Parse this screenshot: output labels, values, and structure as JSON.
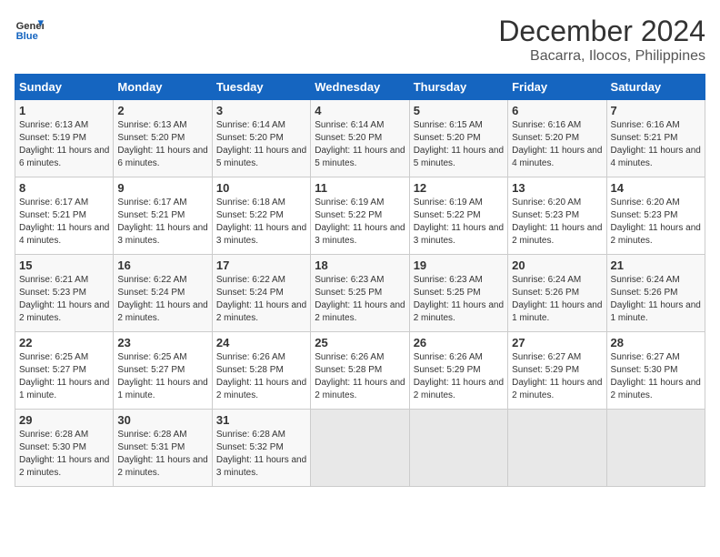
{
  "logo": {
    "line1": "General",
    "line2": "Blue"
  },
  "title": "December 2024",
  "subtitle": "Bacarra, Ilocos, Philippines",
  "days_header": [
    "Sunday",
    "Monday",
    "Tuesday",
    "Wednesday",
    "Thursday",
    "Friday",
    "Saturday"
  ],
  "weeks": [
    [
      {
        "day": "1",
        "sunrise": "6:13 AM",
        "sunset": "5:19 PM",
        "daylight": "11 hours and 6 minutes."
      },
      {
        "day": "2",
        "sunrise": "6:13 AM",
        "sunset": "5:20 PM",
        "daylight": "11 hours and 6 minutes."
      },
      {
        "day": "3",
        "sunrise": "6:14 AM",
        "sunset": "5:20 PM",
        "daylight": "11 hours and 5 minutes."
      },
      {
        "day": "4",
        "sunrise": "6:14 AM",
        "sunset": "5:20 PM",
        "daylight": "11 hours and 5 minutes."
      },
      {
        "day": "5",
        "sunrise": "6:15 AM",
        "sunset": "5:20 PM",
        "daylight": "11 hours and 5 minutes."
      },
      {
        "day": "6",
        "sunrise": "6:16 AM",
        "sunset": "5:20 PM",
        "daylight": "11 hours and 4 minutes."
      },
      {
        "day": "7",
        "sunrise": "6:16 AM",
        "sunset": "5:21 PM",
        "daylight": "11 hours and 4 minutes."
      }
    ],
    [
      {
        "day": "8",
        "sunrise": "6:17 AM",
        "sunset": "5:21 PM",
        "daylight": "11 hours and 4 minutes."
      },
      {
        "day": "9",
        "sunrise": "6:17 AM",
        "sunset": "5:21 PM",
        "daylight": "11 hours and 3 minutes."
      },
      {
        "day": "10",
        "sunrise": "6:18 AM",
        "sunset": "5:22 PM",
        "daylight": "11 hours and 3 minutes."
      },
      {
        "day": "11",
        "sunrise": "6:19 AM",
        "sunset": "5:22 PM",
        "daylight": "11 hours and 3 minutes."
      },
      {
        "day": "12",
        "sunrise": "6:19 AM",
        "sunset": "5:22 PM",
        "daylight": "11 hours and 3 minutes."
      },
      {
        "day": "13",
        "sunrise": "6:20 AM",
        "sunset": "5:23 PM",
        "daylight": "11 hours and 2 minutes."
      },
      {
        "day": "14",
        "sunrise": "6:20 AM",
        "sunset": "5:23 PM",
        "daylight": "11 hours and 2 minutes."
      }
    ],
    [
      {
        "day": "15",
        "sunrise": "6:21 AM",
        "sunset": "5:23 PM",
        "daylight": "11 hours and 2 minutes."
      },
      {
        "day": "16",
        "sunrise": "6:22 AM",
        "sunset": "5:24 PM",
        "daylight": "11 hours and 2 minutes."
      },
      {
        "day": "17",
        "sunrise": "6:22 AM",
        "sunset": "5:24 PM",
        "daylight": "11 hours and 2 minutes."
      },
      {
        "day": "18",
        "sunrise": "6:23 AM",
        "sunset": "5:25 PM",
        "daylight": "11 hours and 2 minutes."
      },
      {
        "day": "19",
        "sunrise": "6:23 AM",
        "sunset": "5:25 PM",
        "daylight": "11 hours and 2 minutes."
      },
      {
        "day": "20",
        "sunrise": "6:24 AM",
        "sunset": "5:26 PM",
        "daylight": "11 hours and 1 minute."
      },
      {
        "day": "21",
        "sunrise": "6:24 AM",
        "sunset": "5:26 PM",
        "daylight": "11 hours and 1 minute."
      }
    ],
    [
      {
        "day": "22",
        "sunrise": "6:25 AM",
        "sunset": "5:27 PM",
        "daylight": "11 hours and 1 minute."
      },
      {
        "day": "23",
        "sunrise": "6:25 AM",
        "sunset": "5:27 PM",
        "daylight": "11 hours and 1 minute."
      },
      {
        "day": "24",
        "sunrise": "6:26 AM",
        "sunset": "5:28 PM",
        "daylight": "11 hours and 2 minutes."
      },
      {
        "day": "25",
        "sunrise": "6:26 AM",
        "sunset": "5:28 PM",
        "daylight": "11 hours and 2 minutes."
      },
      {
        "day": "26",
        "sunrise": "6:26 AM",
        "sunset": "5:29 PM",
        "daylight": "11 hours and 2 minutes."
      },
      {
        "day": "27",
        "sunrise": "6:27 AM",
        "sunset": "5:29 PM",
        "daylight": "11 hours and 2 minutes."
      },
      {
        "day": "28",
        "sunrise": "6:27 AM",
        "sunset": "5:30 PM",
        "daylight": "11 hours and 2 minutes."
      }
    ],
    [
      {
        "day": "29",
        "sunrise": "6:28 AM",
        "sunset": "5:30 PM",
        "daylight": "11 hours and 2 minutes."
      },
      {
        "day": "30",
        "sunrise": "6:28 AM",
        "sunset": "5:31 PM",
        "daylight": "11 hours and 2 minutes."
      },
      {
        "day": "31",
        "sunrise": "6:28 AM",
        "sunset": "5:32 PM",
        "daylight": "11 hours and 3 minutes."
      },
      null,
      null,
      null,
      null
    ]
  ]
}
